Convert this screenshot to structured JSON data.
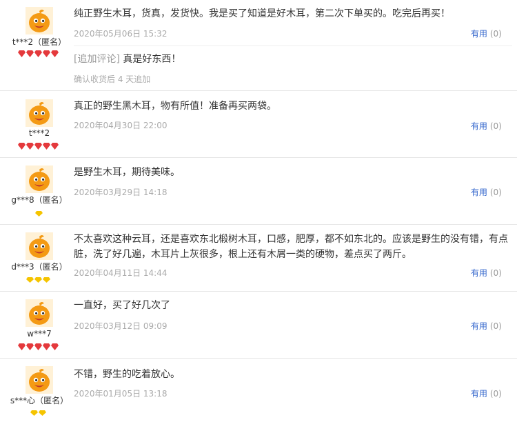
{
  "reviews": [
    {
      "username": "t***2（匿名）",
      "rank_type": "red-gem",
      "rank_count": 5,
      "content": "纯正野生木耳，货真，发货快。我是买了知道是好木耳，第二次下单买的。吃完后再买！",
      "date": "2020年05月06日 15:32",
      "useful_label": "有用",
      "useful_count": "(0)",
      "append": {
        "tag": "[追加评论]",
        "text": "真是好东西！",
        "meta": "确认收货后 4 天追加"
      }
    },
    {
      "username": "t***2",
      "rank_type": "red-gem",
      "rank_count": 5,
      "content": "真正的野生黑木耳，物有所值！准备再买两袋。",
      "date": "2020年04月30日 22:00",
      "useful_label": "有用",
      "useful_count": "(0)"
    },
    {
      "username": "g***8（匿名）",
      "rank_type": "yellow-diamond",
      "rank_count": 1,
      "content": "是野生木耳，期待美味。",
      "date": "2020年03月29日 14:18",
      "useful_label": "有用",
      "useful_count": "(0)"
    },
    {
      "username": "d***3（匿名）",
      "rank_type": "yellow-diamond",
      "rank_count": 3,
      "content": "不太喜欢这种云耳，还是喜欢东北椴树木耳，口感，肥厚，都不如东北的。应该是野生的没有错，有点脏，洗了好几遍，木耳片上灰很多，根上还有木屑一类的硬物，差点买了两斤。",
      "date": "2020年04月11日 14:44",
      "useful_label": "有用",
      "useful_count": "(0)"
    },
    {
      "username": "w***7",
      "rank_type": "red-gem",
      "rank_count": 5,
      "content": "一直好，买了好几次了",
      "date": "2020年03月12日 09:09",
      "useful_label": "有用",
      "useful_count": "(0)"
    },
    {
      "username": "s***心（匿名）",
      "rank_type": "yellow-diamond",
      "rank_count": 2,
      "content": "不错，野生的吃着放心。",
      "date": "2020年01月05日 13:18",
      "useful_label": "有用",
      "useful_count": "(0)"
    }
  ],
  "colors": {
    "link": "#3366cc",
    "date": "#aaaaaa",
    "red_gem": "#e4393c",
    "yellow_diamond": "#f5c400",
    "avatar_orange": "#f49a14"
  }
}
